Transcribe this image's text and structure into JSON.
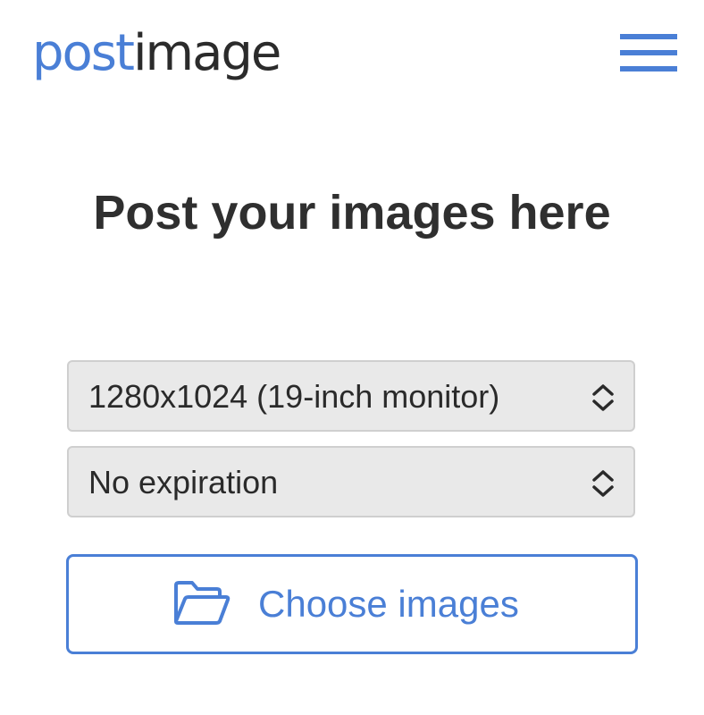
{
  "header": {
    "logo_part_a": "post",
    "logo_part_b": "image",
    "menu_icon": "hamburger-icon"
  },
  "main": {
    "title": "Post your images here",
    "resize_select": {
      "selected": "1280x1024 (19-inch monitor)",
      "icon": "chevron-up-down-icon"
    },
    "expiration_select": {
      "selected": "No expiration",
      "icon": "chevron-up-down-icon"
    },
    "choose_button": {
      "label": "Choose images",
      "icon": "folder-open-icon"
    }
  },
  "colors": {
    "accent": "#4a7fd6",
    "logo_dark": "#2b2b2b",
    "title_text": "#2f2f2f",
    "select_bg": "#e9e9e9",
    "select_border": "#cfcfcf"
  }
}
